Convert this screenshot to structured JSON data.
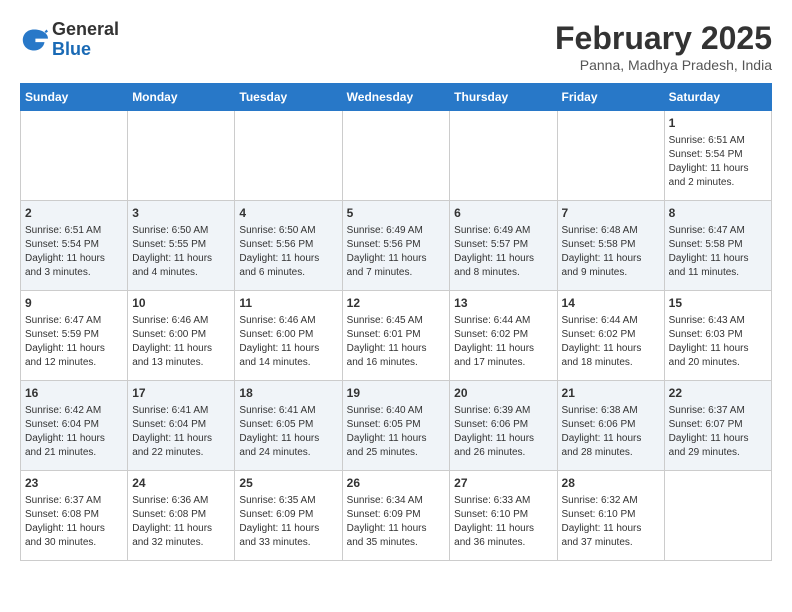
{
  "header": {
    "logo_general": "General",
    "logo_blue": "Blue",
    "month_title": "February 2025",
    "location": "Panna, Madhya Pradesh, India"
  },
  "days_of_week": [
    "Sunday",
    "Monday",
    "Tuesday",
    "Wednesday",
    "Thursday",
    "Friday",
    "Saturday"
  ],
  "weeks": [
    [
      {
        "day": "",
        "info": ""
      },
      {
        "day": "",
        "info": ""
      },
      {
        "day": "",
        "info": ""
      },
      {
        "day": "",
        "info": ""
      },
      {
        "day": "",
        "info": ""
      },
      {
        "day": "",
        "info": ""
      },
      {
        "day": "1",
        "info": "Sunrise: 6:51 AM\nSunset: 5:54 PM\nDaylight: 11 hours\nand 2 minutes."
      }
    ],
    [
      {
        "day": "2",
        "info": "Sunrise: 6:51 AM\nSunset: 5:54 PM\nDaylight: 11 hours\nand 3 minutes."
      },
      {
        "day": "3",
        "info": "Sunrise: 6:50 AM\nSunset: 5:55 PM\nDaylight: 11 hours\nand 4 minutes."
      },
      {
        "day": "4",
        "info": "Sunrise: 6:50 AM\nSunset: 5:56 PM\nDaylight: 11 hours\nand 6 minutes."
      },
      {
        "day": "5",
        "info": "Sunrise: 6:49 AM\nSunset: 5:56 PM\nDaylight: 11 hours\nand 7 minutes."
      },
      {
        "day": "6",
        "info": "Sunrise: 6:49 AM\nSunset: 5:57 PM\nDaylight: 11 hours\nand 8 minutes."
      },
      {
        "day": "7",
        "info": "Sunrise: 6:48 AM\nSunset: 5:58 PM\nDaylight: 11 hours\nand 9 minutes."
      },
      {
        "day": "8",
        "info": "Sunrise: 6:47 AM\nSunset: 5:58 PM\nDaylight: 11 hours\nand 11 minutes."
      }
    ],
    [
      {
        "day": "9",
        "info": "Sunrise: 6:47 AM\nSunset: 5:59 PM\nDaylight: 11 hours\nand 12 minutes."
      },
      {
        "day": "10",
        "info": "Sunrise: 6:46 AM\nSunset: 6:00 PM\nDaylight: 11 hours\nand 13 minutes."
      },
      {
        "day": "11",
        "info": "Sunrise: 6:46 AM\nSunset: 6:00 PM\nDaylight: 11 hours\nand 14 minutes."
      },
      {
        "day": "12",
        "info": "Sunrise: 6:45 AM\nSunset: 6:01 PM\nDaylight: 11 hours\nand 16 minutes."
      },
      {
        "day": "13",
        "info": "Sunrise: 6:44 AM\nSunset: 6:02 PM\nDaylight: 11 hours\nand 17 minutes."
      },
      {
        "day": "14",
        "info": "Sunrise: 6:44 AM\nSunset: 6:02 PM\nDaylight: 11 hours\nand 18 minutes."
      },
      {
        "day": "15",
        "info": "Sunrise: 6:43 AM\nSunset: 6:03 PM\nDaylight: 11 hours\nand 20 minutes."
      }
    ],
    [
      {
        "day": "16",
        "info": "Sunrise: 6:42 AM\nSunset: 6:04 PM\nDaylight: 11 hours\nand 21 minutes."
      },
      {
        "day": "17",
        "info": "Sunrise: 6:41 AM\nSunset: 6:04 PM\nDaylight: 11 hours\nand 22 minutes."
      },
      {
        "day": "18",
        "info": "Sunrise: 6:41 AM\nSunset: 6:05 PM\nDaylight: 11 hours\nand 24 minutes."
      },
      {
        "day": "19",
        "info": "Sunrise: 6:40 AM\nSunset: 6:05 PM\nDaylight: 11 hours\nand 25 minutes."
      },
      {
        "day": "20",
        "info": "Sunrise: 6:39 AM\nSunset: 6:06 PM\nDaylight: 11 hours\nand 26 minutes."
      },
      {
        "day": "21",
        "info": "Sunrise: 6:38 AM\nSunset: 6:06 PM\nDaylight: 11 hours\nand 28 minutes."
      },
      {
        "day": "22",
        "info": "Sunrise: 6:37 AM\nSunset: 6:07 PM\nDaylight: 11 hours\nand 29 minutes."
      }
    ],
    [
      {
        "day": "23",
        "info": "Sunrise: 6:37 AM\nSunset: 6:08 PM\nDaylight: 11 hours\nand 30 minutes."
      },
      {
        "day": "24",
        "info": "Sunrise: 6:36 AM\nSunset: 6:08 PM\nDaylight: 11 hours\nand 32 minutes."
      },
      {
        "day": "25",
        "info": "Sunrise: 6:35 AM\nSunset: 6:09 PM\nDaylight: 11 hours\nand 33 minutes."
      },
      {
        "day": "26",
        "info": "Sunrise: 6:34 AM\nSunset: 6:09 PM\nDaylight: 11 hours\nand 35 minutes."
      },
      {
        "day": "27",
        "info": "Sunrise: 6:33 AM\nSunset: 6:10 PM\nDaylight: 11 hours\nand 36 minutes."
      },
      {
        "day": "28",
        "info": "Sunrise: 6:32 AM\nSunset: 6:10 PM\nDaylight: 11 hours\nand 37 minutes."
      },
      {
        "day": "",
        "info": ""
      }
    ]
  ]
}
